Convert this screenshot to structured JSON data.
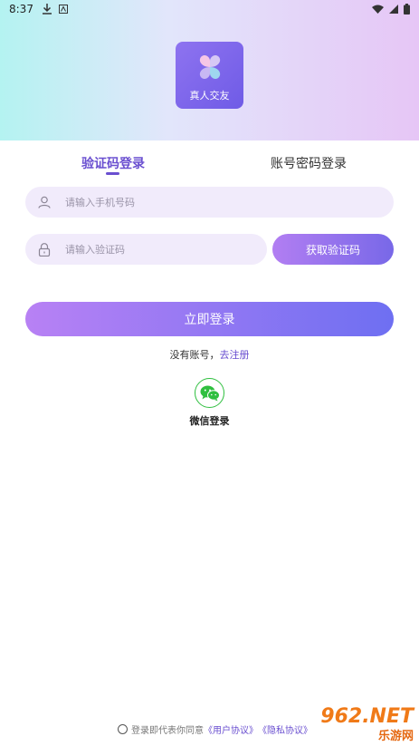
{
  "status_bar": {
    "time": "8:37",
    "icons_left": [
      "download-icon",
      "app-notification-icon"
    ],
    "icons_right": [
      "wifi-icon",
      "signal-icon",
      "battery-icon"
    ]
  },
  "app": {
    "logo_text": "真人交友",
    "accent_color": "#6a4fd0"
  },
  "tabs": [
    {
      "label": "验证码登录",
      "active": true
    },
    {
      "label": "账号密码登录",
      "active": false
    }
  ],
  "phone_field": {
    "placeholder": "请输入手机号码",
    "icon": "user-icon"
  },
  "code_field": {
    "placeholder": "请输入验证码",
    "icon": "lock-icon"
  },
  "get_code_button": "获取验证码",
  "login_button": "立即登录",
  "register": {
    "prefix": "没有账号，",
    "link": "去注册"
  },
  "wechat_login": {
    "label": "微信登录",
    "icon": "wechat-icon"
  },
  "agreement": {
    "text": "登录即代表你同意",
    "user_agreement": "《用户协议》",
    "privacy_policy": "《隐私协议》"
  },
  "watermark": {
    "main": "962.NET",
    "sub": "乐游网"
  }
}
